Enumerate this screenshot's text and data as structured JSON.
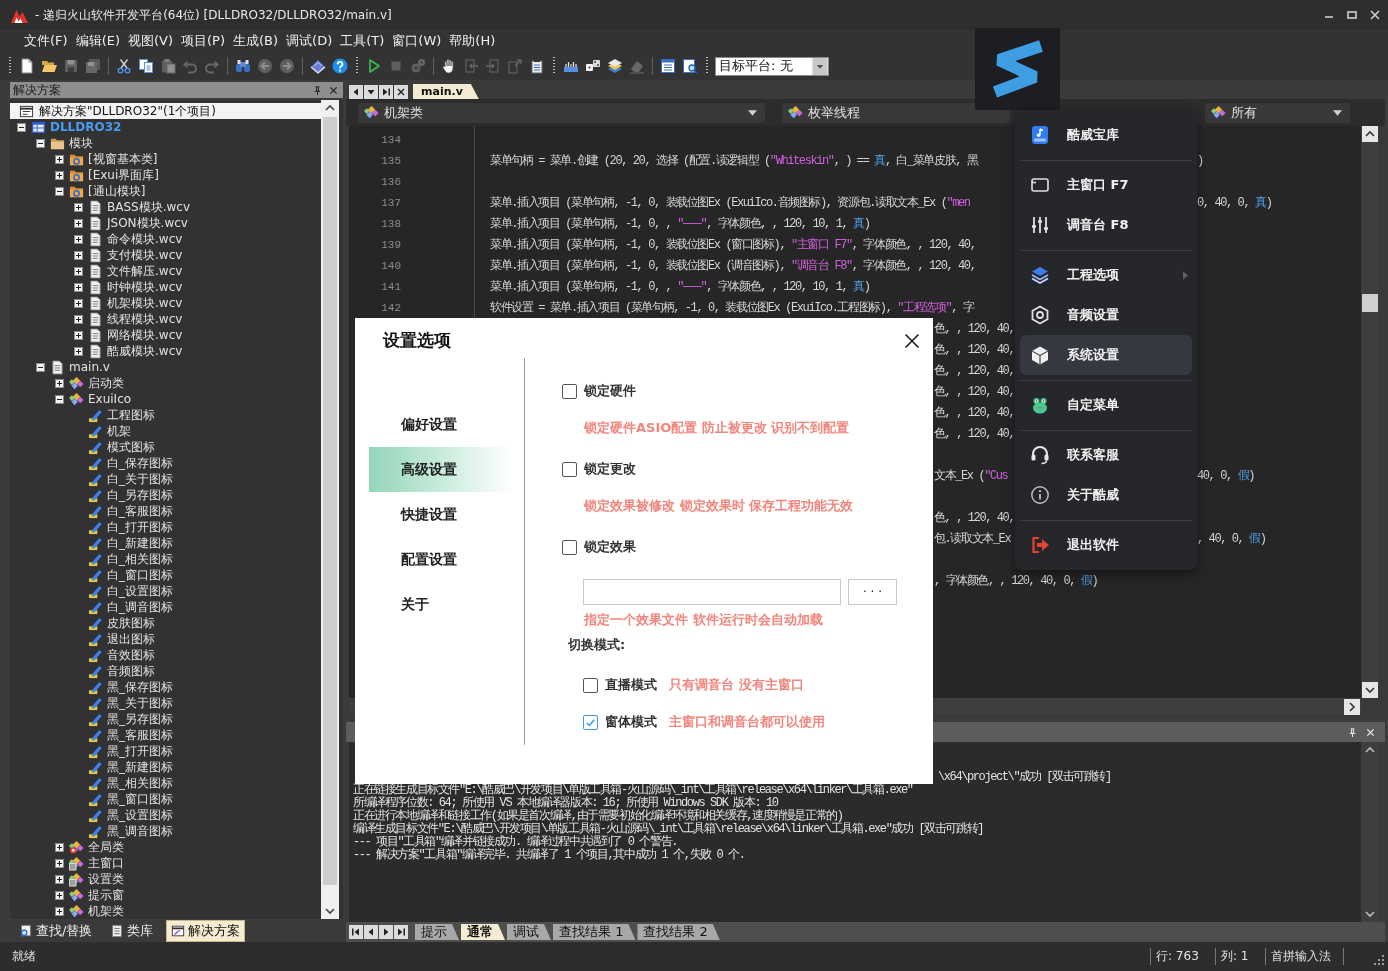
{
  "window": {
    "title": "- 递归火山软件开发平台(64位) [DLLDRO32/DLLDRO32/main.v]"
  },
  "menu_bar": {
    "items": [
      "文件(F)",
      "编辑(E)",
      "视图(V)",
      "项目(P)",
      "生成(B)",
      "调试(D)",
      "工具(T)",
      "窗口(W)",
      "帮助(H)"
    ]
  },
  "toolbar": {
    "groups": [
      {
        "grip": true,
        "buttons": [
          {
            "kind": "new",
            "disabled": false
          },
          {
            "kind": "open",
            "disabled": false
          },
          {
            "kind": "save",
            "disabled": true
          },
          {
            "kind": "save_all",
            "disabled": true
          }
        ]
      },
      {
        "grip": false,
        "buttons": [
          {
            "kind": "cut",
            "disabled": false
          },
          {
            "kind": "copy",
            "disabled": false
          },
          {
            "kind": "paste",
            "disabled": true
          },
          {
            "kind": "undo",
            "disabled": true
          },
          {
            "kind": "redo",
            "disabled": true
          }
        ]
      },
      {
        "grip": false,
        "buttons": [
          {
            "kind": "find",
            "disabled": false
          },
          {
            "kind": "back",
            "disabled": true
          },
          {
            "kind": "forward",
            "disabled": true
          }
        ]
      },
      {
        "grip": false,
        "buttons": [
          {
            "kind": "book",
            "disabled": false
          },
          {
            "kind": "help",
            "disabled": false
          }
        ]
      },
      {
        "grip": true,
        "buttons": [
          {
            "kind": "run",
            "disabled": false
          },
          {
            "kind": "stop",
            "disabled": true
          },
          {
            "kind": "build",
            "disabled": true
          }
        ]
      },
      {
        "grip": false,
        "buttons": [
          {
            "kind": "hand",
            "disabled": false
          },
          {
            "kind": "step_into",
            "disabled": true
          },
          {
            "kind": "step_over",
            "disabled": true
          },
          {
            "kind": "step_out",
            "disabled": true
          },
          {
            "kind": "clipboard_list",
            "disabled": false
          }
        ]
      },
      {
        "grip": true,
        "buttons": [
          {
            "kind": "ruler",
            "disabled": false
          },
          {
            "kind": "dice",
            "disabled": false
          },
          {
            "kind": "stack",
            "disabled": false
          },
          {
            "kind": "eraser",
            "disabled": true
          }
        ]
      },
      {
        "grip": false,
        "buttons": [
          {
            "kind": "list",
            "disabled": false
          },
          {
            "kind": "preview",
            "disabled": false
          }
        ]
      }
    ],
    "target_platform": "目标平台: 无"
  },
  "solution_explorer": {
    "title": "解决方案",
    "header": "解决方案\"DLLDRO32\"(1个项目)",
    "tree": [
      {
        "label": "DLLDRO32",
        "kind": "project",
        "expanded": true,
        "children": [
          {
            "label": "模块",
            "kind": "folder",
            "expanded": true,
            "children": [
              {
                "label": "[视窗基本类]",
                "kind": "library",
                "expanded": false
              },
              {
                "label": "[Exui界面库]",
                "kind": "library",
                "expanded": false
              },
              {
                "label": "[通山模块]",
                "kind": "library",
                "expanded": true,
                "children": [
                  {
                    "label": "BASS模块.wcv",
                    "kind": "file",
                    "expanded": false
                  },
                  {
                    "label": "JSON模块.wcv",
                    "kind": "file",
                    "expanded": false
                  },
                  {
                    "label": "命令模块.wcv",
                    "kind": "file",
                    "expanded": false
                  },
                  {
                    "label": "支付模块.wcv",
                    "kind": "file",
                    "expanded": false
                  },
                  {
                    "label": "文件解压.wcv",
                    "kind": "file",
                    "expanded": false
                  },
                  {
                    "label": "时钟模块.wcv",
                    "kind": "file",
                    "expanded": false
                  },
                  {
                    "label": "机架模块.wcv",
                    "kind": "file",
                    "expanded": false
                  },
                  {
                    "label": "线程模块.wcv",
                    "kind": "file",
                    "expanded": false
                  },
                  {
                    "label": "网络模块.wcv",
                    "kind": "file",
                    "expanded": false
                  },
                  {
                    "label": "酷威模块.wcv",
                    "kind": "file",
                    "expanded": false
                  }
                ]
              }
            ]
          },
          {
            "label": "main.v",
            "kind": "file",
            "expanded": true,
            "children": [
              {
                "label": "启动类",
                "kind": "class",
                "expanded": false
              },
              {
                "label": "ExuiIco",
                "kind": "class",
                "expanded": true,
                "children": [
                  {
                    "label": "工程图标",
                    "kind": "member"
                  },
                  {
                    "label": "机架",
                    "kind": "member"
                  },
                  {
                    "label": "模式图标",
                    "kind": "member"
                  },
                  {
                    "label": "白_保存图标",
                    "kind": "member"
                  },
                  {
                    "label": "白_关于图标",
                    "kind": "member"
                  },
                  {
                    "label": "白_另存图标",
                    "kind": "member"
                  },
                  {
                    "label": "白_客服图标",
                    "kind": "member"
                  },
                  {
                    "label": "白_打开图标",
                    "kind": "member"
                  },
                  {
                    "label": "白_新建图标",
                    "kind": "member"
                  },
                  {
                    "label": "白_相关图标",
                    "kind": "member"
                  },
                  {
                    "label": "白_窗口图标",
                    "kind": "member"
                  },
                  {
                    "label": "白_设置图标",
                    "kind": "member"
                  },
                  {
                    "label": "白_调音图标",
                    "kind": "member"
                  },
                  {
                    "label": "皮肤图标",
                    "kind": "member"
                  },
                  {
                    "label": "退出图标",
                    "kind": "member"
                  },
                  {
                    "label": "音效图标",
                    "kind": "member"
                  },
                  {
                    "label": "音频图标",
                    "kind": "member"
                  },
                  {
                    "label": "黑_保存图标",
                    "kind": "member"
                  },
                  {
                    "label": "黑_关于图标",
                    "kind": "member"
                  },
                  {
                    "label": "黑_另存图标",
                    "kind": "member"
                  },
                  {
                    "label": "黑_客服图标",
                    "kind": "member"
                  },
                  {
                    "label": "黑_打开图标",
                    "kind": "member"
                  },
                  {
                    "label": "黑_新建图标",
                    "kind": "member"
                  },
                  {
                    "label": "黑_相关图标",
                    "kind": "member"
                  },
                  {
                    "label": "黑_窗口图标",
                    "kind": "member"
                  },
                  {
                    "label": "黑_设置图标",
                    "kind": "member"
                  },
                  {
                    "label": "黑_调音图标",
                    "kind": "member"
                  }
                ]
              },
              {
                "label": "全局类",
                "kind": "global_class",
                "expanded": false
              },
              {
                "label": "主窗口",
                "kind": "window_class",
                "expanded": false
              },
              {
                "label": "设置类",
                "kind": "window_class",
                "expanded": false
              },
              {
                "label": "提示窗",
                "kind": "class",
                "expanded": false
              },
              {
                "label": "机架类",
                "kind": "class",
                "expanded": false
              }
            ]
          }
        ]
      }
    ],
    "tabs": [
      {
        "label": "查找/替换",
        "kind": "find",
        "selected": false
      },
      {
        "label": "类库",
        "kind": "library",
        "selected": false
      },
      {
        "label": "解决方案",
        "kind": "solution",
        "selected": true
      }
    ]
  },
  "editor": {
    "tabs": [
      {
        "label": "main.v",
        "selected": true
      }
    ],
    "class_selector": "机架类",
    "method_selector": "枚举线程",
    "filter_selector": "所有",
    "line_groups": [
      {
        "lines": [
          {
            "number": "134"
          },
          {
            "number": "135",
            "code": [
              {
                "text": "菜单句柄 = 菜单.创建 (20, 20, 选择 (配置.读逻辑型 (",
                "kind": "plain"
              },
              {
                "text": "\"Whiteskin\"",
                "kind": "string"
              },
              {
                "text": ", ) == ",
                "kind": "plain"
              },
              {
                "text": "真",
                "kind": "keyword"
              },
              {
                "text": ", 白_菜单皮肤, 黑",
                "kind": "plain"
              }
            ],
            "code_after_menu": [
              {
                "text": ")",
                "kind": "plain"
              }
            ]
          },
          {
            "number": "136"
          },
          {
            "number": "137",
            "code": [
              {
                "text": "菜单.插入项目 (菜单句柄, -1, 0, 装载位图Ex (ExuiIco.音频图标), 资源包.读取文本_Ex (",
                "kind": "plain"
              },
              {
                "text": "\"men",
                "kind": "string"
              }
            ],
            "code_after_menu": [
              {
                "text": "0, 40, 0, ",
                "kind": "plain"
              },
              {
                "text": "真",
                "kind": "keyword"
              },
              {
                "text": ")",
                "kind": "plain"
              }
            ]
          },
          {
            "number": "138",
            "code": [
              {
                "text": "菜单.插入项目 (菜单句柄, -1, 0, , ",
                "kind": "plain"
              },
              {
                "text": "\"———\"",
                "kind": "string"
              },
              {
                "text": ", 字体颜色, , 120, 10, 1, ",
                "kind": "plain"
              },
              {
                "text": "真",
                "kind": "keyword"
              },
              {
                "text": ")",
                "kind": "plain"
              }
            ]
          },
          {
            "number": "139",
            "code": [
              {
                "text": "菜单.插入项目 (菜单句柄, -1, 0, 装载位图Ex (窗口图标), ",
                "kind": "plain"
              },
              {
                "text": "\"主窗口 F7\"",
                "kind": "string"
              },
              {
                "text": ", 字体颜色, , 120, 40,",
                "kind": "plain"
              }
            ]
          },
          {
            "number": "140",
            "code": [
              {
                "text": "菜单.插入项目 (菜单句柄, -1, 0, 装载位图Ex (调音图标), ",
                "kind": "plain"
              },
              {
                "text": "\"调音台 F8\"",
                "kind": "string"
              },
              {
                "text": ", 字体颜色, , 120, 40,",
                "kind": "plain"
              }
            ]
          },
          {
            "number": "141",
            "code": [
              {
                "text": "菜单.插入项目 (菜单句柄, -1, 0, , ",
                "kind": "plain"
              },
              {
                "text": "\"———\"",
                "kind": "string"
              },
              {
                "text": ", 字体颜色, , 120, 10, 1, ",
                "kind": "plain"
              },
              {
                "text": "真",
                "kind": "keyword"
              },
              {
                "text": ")",
                "kind": "plain"
              }
            ]
          },
          {
            "number": "142",
            "code": [
              {
                "text": "软件设置 = 菜单.插入项目 (菜单句柄, -1, 0, 装载位图Ex (ExuiIco.工程图标), ",
                "kind": "plain"
              },
              {
                "text": "\"工程选项\"",
                "kind": "string"
              },
              {
                "text": ", 字",
                "kind": "plain"
              }
            ]
          },
          {
            "code_after_dialog": [
              {
                "text": "色, , 120, 40,",
                "kind": "plain"
              }
            ]
          },
          {
            "code_after_dialog": [
              {
                "text": "色, , 120, 40,",
                "kind": "plain"
              }
            ]
          },
          {
            "code_after_dialog": [
              {
                "text": "色, , 120, 40,",
                "kind": "plain"
              }
            ]
          },
          {
            "code_after_dialog": [
              {
                "text": "色, , 120, 40,",
                "kind": "plain"
              }
            ]
          },
          {
            "code_after_dialog": [
              {
                "text": "色, , 120, 40,",
                "kind": "plain"
              }
            ]
          },
          {
            "code_after_dialog": [
              {
                "text": "色, , 120, 40,",
                "kind": "plain"
              }
            ]
          }
        ]
      },
      {
        "lines": [
          {
            "code_after_dialog": [
              {
                "text": "文本_Ex (",
                "kind": "plain"
              },
              {
                "text": "\"Cus",
                "kind": "string"
              }
            ],
            "code_after_menu": [
              {
                "text": "40, 0, ",
                "kind": "plain"
              },
              {
                "text": "假",
                "kind": "keyword"
              },
              {
                "text": ")",
                "kind": "plain"
              }
            ]
          }
        ]
      },
      {
        "lines": [
          {
            "code_after_dialog": [
              {
                "text": "色, , 120, 40,",
                "kind": "plain"
              }
            ]
          },
          {
            "code_after_dialog": [
              {
                "text": "包.读取文本_Ex",
                "kind": "plain"
              }
            ],
            "code_after_menu": [
              {
                "text": ", 40, 0, ",
                "kind": "plain"
              },
              {
                "text": "假",
                "kind": "keyword"
              },
              {
                "text": ")",
                "kind": "plain"
              }
            ]
          }
        ]
      },
      {
        "lines": [
          {
            "code_after_dialog": [
              {
                "text": ", 字体颜色, , 120, 40, 0, ",
                "kind": "plain"
              },
              {
                "text": "假",
                "kind": "keyword"
              },
              {
                "text": ")",
                "kind": "plain"
              }
            ]
          }
        ]
      }
    ]
  },
  "popup_menu": {
    "items": [
      {
        "kind": "music_app",
        "label": "酷威宝库",
        "selected": false,
        "submenu": false
      },
      {
        "kind": "separator"
      },
      {
        "kind": "window",
        "label": "主窗口 F7",
        "selected": false,
        "submenu": false
      },
      {
        "kind": "sliders",
        "label": "调音台 F8",
        "selected": false,
        "submenu": false
      },
      {
        "kind": "separator"
      },
      {
        "kind": "layers",
        "label": "工程选项",
        "selected": false,
        "submenu": true
      },
      {
        "kind": "hexagon",
        "label": "音频设置",
        "selected": false,
        "submenu": false
      },
      {
        "kind": "cube",
        "label": "系统设置",
        "selected": true,
        "submenu": false
      },
      {
        "kind": "separator"
      },
      {
        "kind": "frog",
        "label": "自定菜单",
        "selected": false,
        "submenu": false
      },
      {
        "kind": "separator"
      },
      {
        "kind": "headset",
        "label": "联系客服",
        "selected": false,
        "submenu": false
      },
      {
        "kind": "info",
        "label": "关于酷威",
        "selected": false,
        "submenu": false
      },
      {
        "kind": "separator"
      },
      {
        "kind": "exit",
        "label": "退出软件",
        "selected": false,
        "submenu": false
      }
    ]
  },
  "settings_dialog": {
    "title": "设置选项",
    "nav": [
      {
        "label": "偏好设置",
        "selected": false
      },
      {
        "label": "高级设置",
        "selected": true
      },
      {
        "label": "快捷设置",
        "selected": false
      },
      {
        "label": "配置设置",
        "selected": false
      },
      {
        "label": "关于",
        "selected": false
      }
    ],
    "options": [
      {
        "kind": "checkbox",
        "label": "锁定硬件",
        "checked": false
      },
      {
        "kind": "hint",
        "text": "锁定硬件ASIO配置 防止被更改 识别不到配置"
      },
      {
        "kind": "checkbox",
        "label": "锁定更改",
        "checked": false
      },
      {
        "kind": "hint",
        "text": "锁定效果被修改 锁定效果时 保存工程功能无效"
      },
      {
        "kind": "checkbox",
        "label": "锁定效果",
        "checked": false
      },
      {
        "kind": "file_picker",
        "button": "· · ·"
      },
      {
        "kind": "hint",
        "text": "指定一个效果文件 软件运行时会自动加载"
      },
      {
        "kind": "heading",
        "text": "切换模式:"
      },
      {
        "kind": "mode",
        "label": "直播模式",
        "checked": false,
        "hint": "只有调音台 没有主窗口"
      },
      {
        "kind": "mode",
        "label": "窗体模式",
        "checked": true,
        "hint": "主窗口和调音台都可以使用"
      }
    ]
  },
  "output": {
    "lines": [
      {
        "text_after_dialog": "\\x64\\project\\\"成功 [双击可跳转]"
      },
      {
        "text": "正在链接生成目标文件\"E:\\酷威巴\\开发项目\\单版工具箱-火山源码\\_int\\工具箱\\release\\x64\\linker\\工具箱.exe\""
      },
      {
        "text": "所编译程序位数: 64; 所使用 VS 本地编译器版本: 16; 所使用 Windows SDK 版本: 10"
      },
      {
        "text": "正在进行本地编译和链接工作(如果是首次编译,由于需要初始化编译环境和相关缓存,速度稍慢是正常的)"
      },
      {
        "text": "编译生成目标文件\"E:\\酷威巴\\开发项目\\单版工具箱-火山源码\\_int\\工具箱\\release\\x64\\linker\\工具箱.exe\"成功 [双击可跳转]"
      },
      {
        "text": "--- 项目\"工具箱\"编译并链接成功. 编译过程中共遇到了 0 个警告."
      },
      {
        "text": "--- 解决方案\"工具箱\"编译完毕. 共编译了 1 个项目,其中成功 1 个,失败 0 个."
      }
    ],
    "tabs": [
      {
        "label": "提示",
        "selected": false
      },
      {
        "label": "通常",
        "selected": true
      },
      {
        "label": "调试",
        "selected": false
      },
      {
        "label": "查找结果 1",
        "selected": false
      },
      {
        "label": "查找结果 2",
        "selected": false
      }
    ]
  },
  "status_bar": {
    "message": "就绪",
    "line": "行: 763",
    "column": "列: 1",
    "input_method": "首拼输入法"
  }
}
